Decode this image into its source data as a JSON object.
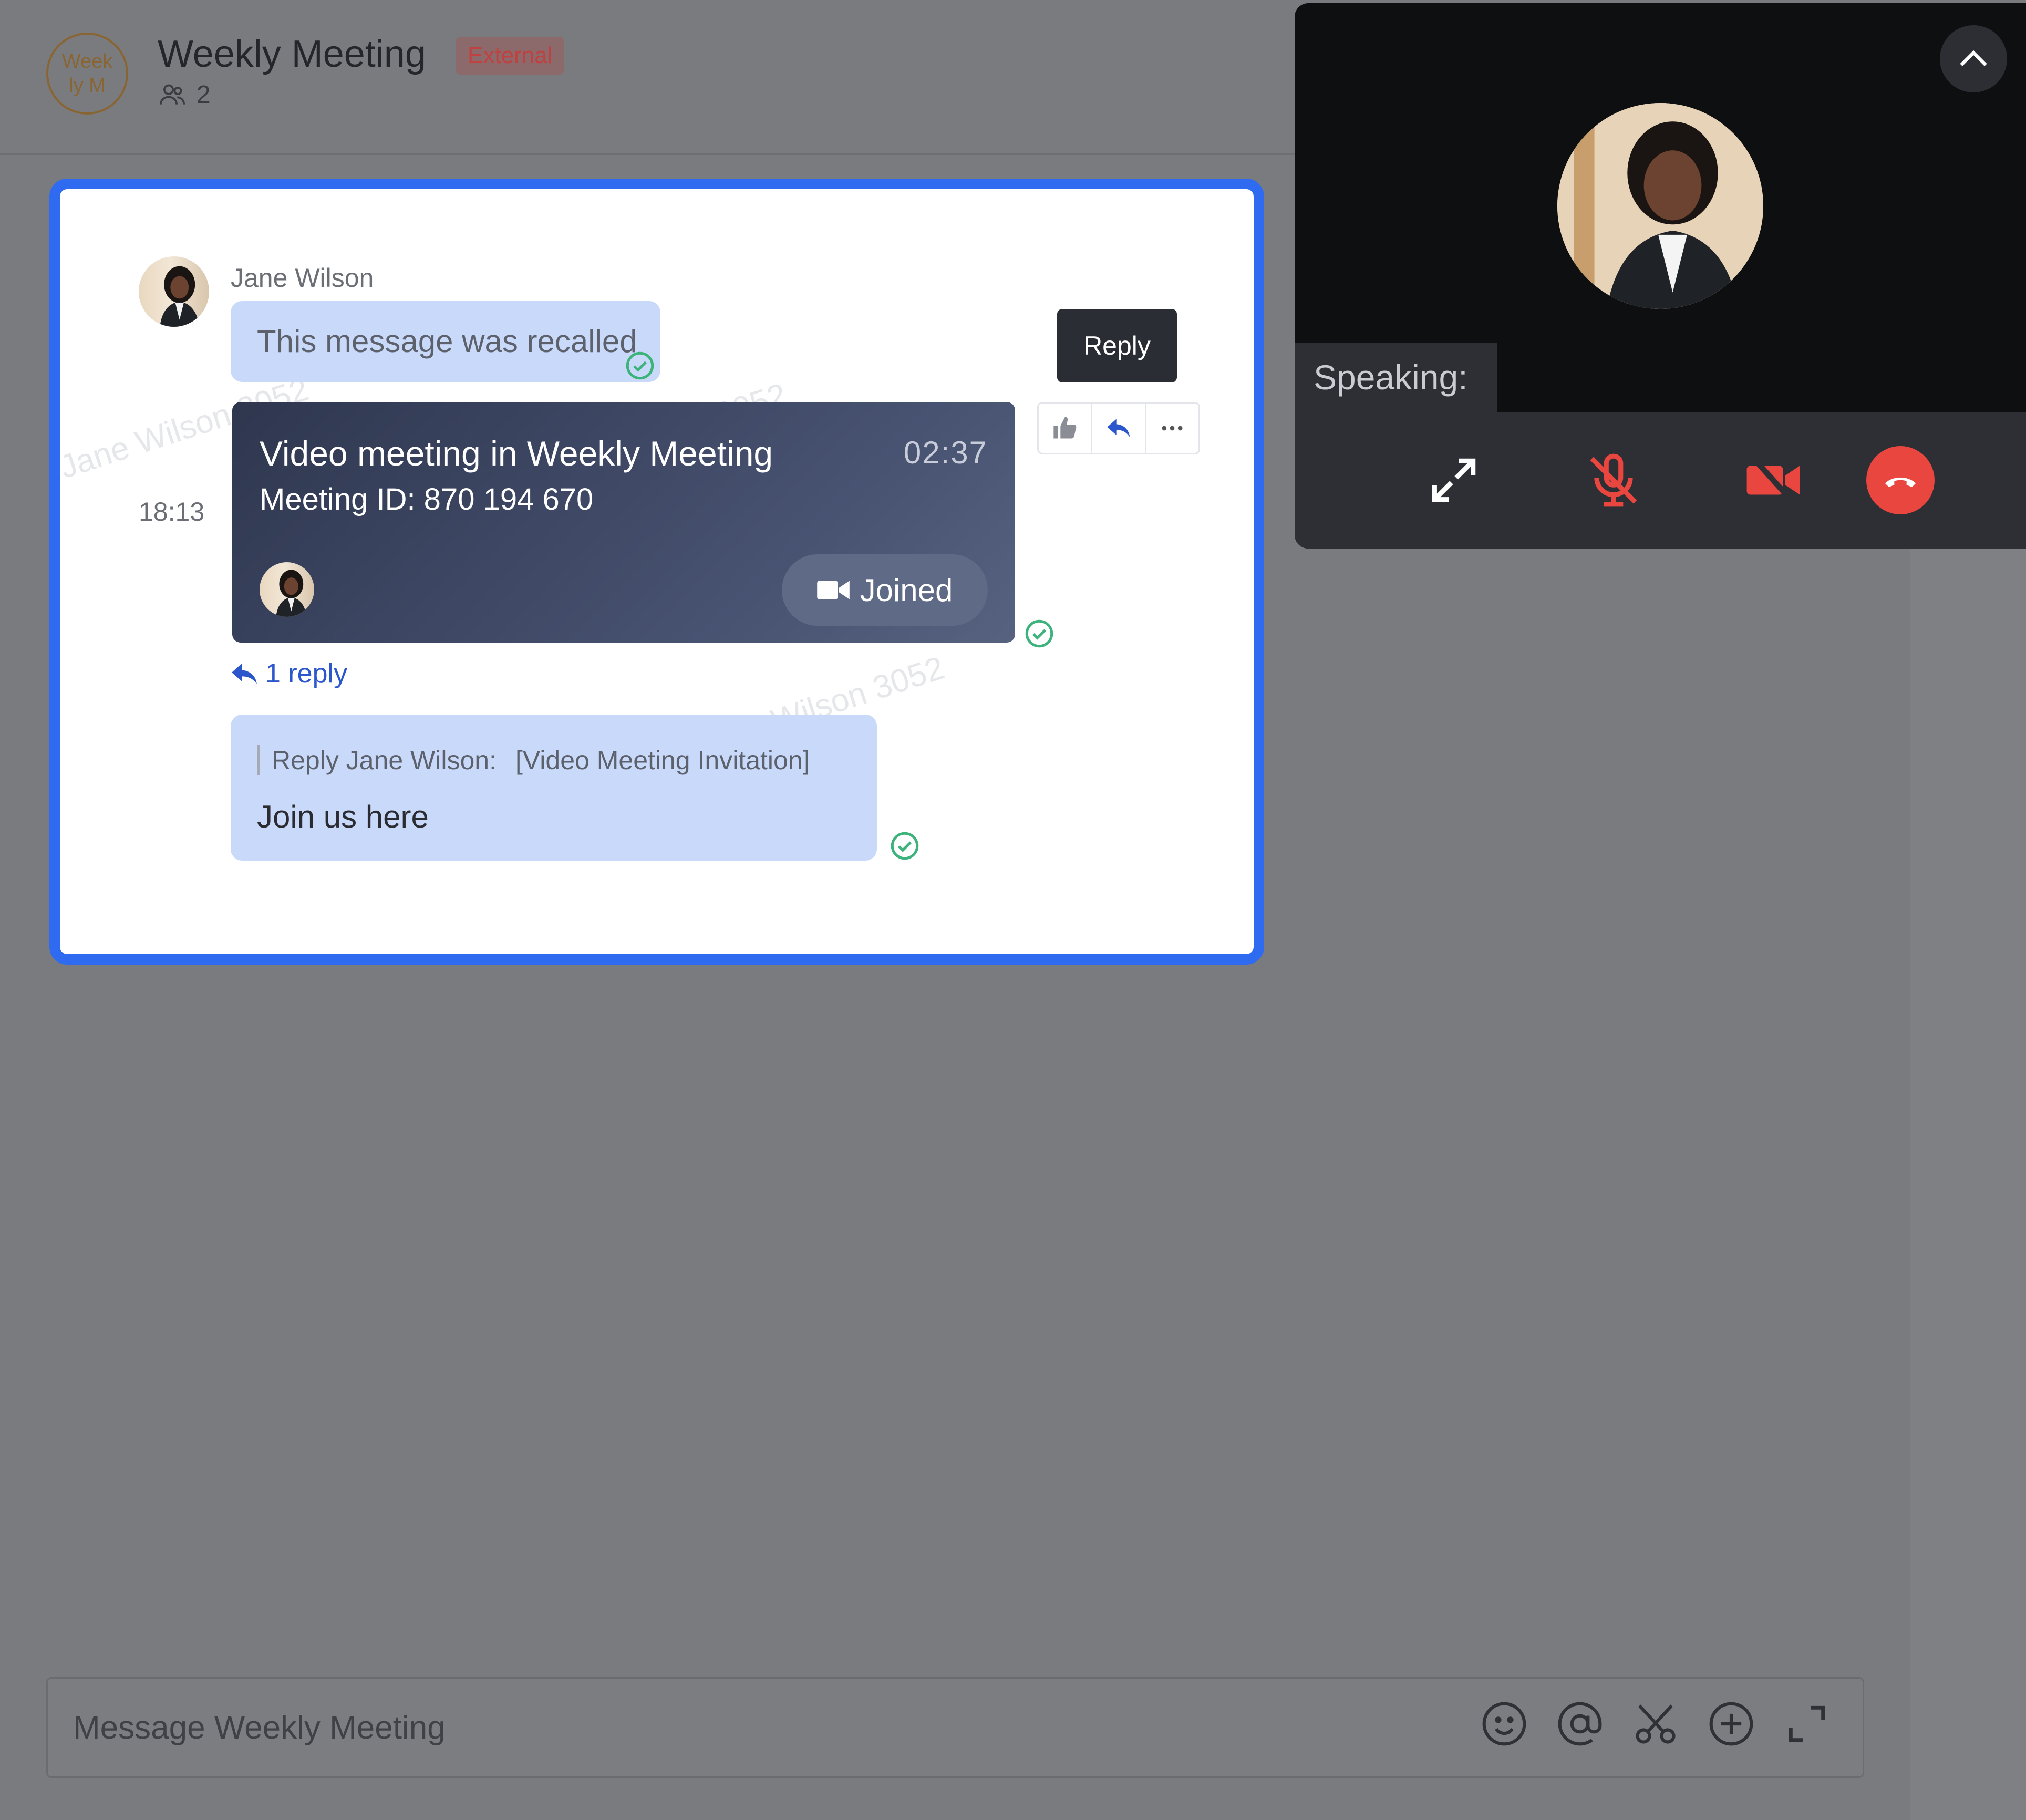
{
  "header": {
    "avatar_text": "Week ly M",
    "title": "Weekly Meeting",
    "badge": "External",
    "member_count": "2"
  },
  "message": {
    "sender": "Jane Wilson",
    "recalled_text": "This message was recalled",
    "time": "18:13",
    "meeting": {
      "title": "Video meeting in Weekly Meeting",
      "duration": "02:37",
      "meeting_id": "Meeting ID: 870 194 670",
      "joined_label": "Joined"
    },
    "reply_count": "1 reply",
    "reply": {
      "quote_name": "Reply Jane Wilson:",
      "quote_text": "[Video Meeting Invitation]",
      "text": "Join us here"
    },
    "tooltip": "Reply",
    "watermark": "Jane Wilson 3052"
  },
  "call": {
    "speaking_label": "Speaking:"
  },
  "composer": {
    "placeholder": "Message Weekly Meeting"
  },
  "colors": {
    "accent": "#2f6bf0",
    "bubble": "#c9d9fa",
    "hangup": "#e8463f",
    "check": "#3bb37a"
  }
}
